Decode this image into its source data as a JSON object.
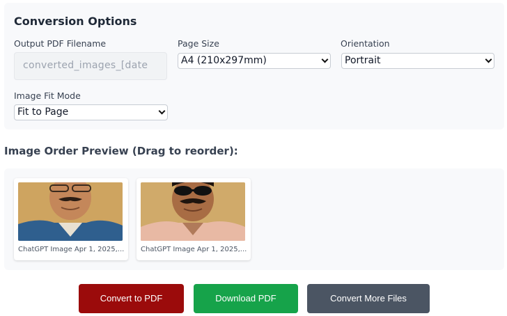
{
  "options": {
    "title": "Conversion Options",
    "filename": {
      "label": "Output PDF Filename",
      "placeholder": "converted_images_[date"
    },
    "page_size": {
      "label": "Page Size",
      "value": "A4 (210x297mm)"
    },
    "orientation": {
      "label": "Orientation",
      "value": "Portrait"
    },
    "fit_mode": {
      "label": "Image Fit Mode",
      "value": "Fit to Page"
    }
  },
  "preview": {
    "title": "Image Order Preview (Drag to reorder):",
    "images": [
      {
        "caption": "ChatGPT Image Apr 1, 2025,..."
      },
      {
        "caption": "ChatGPT Image Apr 1, 2025,..."
      }
    ]
  },
  "actions": {
    "convert_label": "Convert to PDF",
    "download_label": "Download PDF",
    "more_label": "Convert More Files"
  },
  "colors": {
    "convert": "#9b0b0b",
    "download": "#16a34a",
    "more": "#4b5563"
  }
}
